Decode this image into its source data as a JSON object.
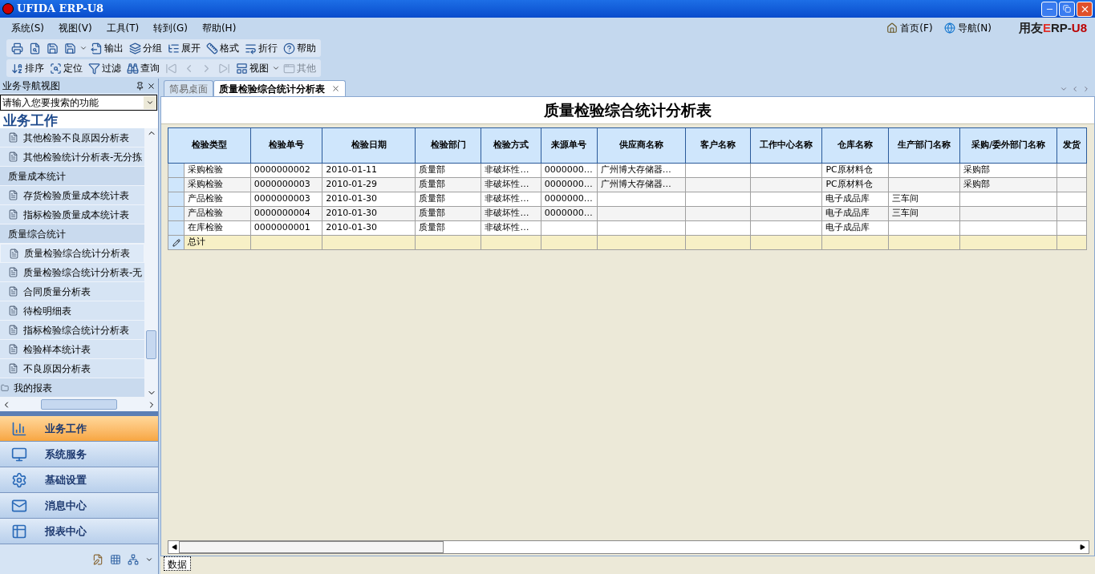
{
  "window": {
    "title": "UFIDA ERP-U8"
  },
  "menu": [
    "系统(S)",
    "视图(V)",
    "工具(T)",
    "转到(G)",
    "帮助(H)"
  ],
  "top_links": [
    "首页(F)",
    "导航(N)"
  ],
  "logo": [
    "用友",
    "E",
    "RP-",
    "U8"
  ],
  "toolbar1": [
    {
      "kind": "print"
    },
    {
      "kind": "preview"
    },
    {
      "kind": "export-disk"
    },
    {
      "kind": "save"
    },
    {
      "kind": "dropdown"
    },
    {
      "kind": "output",
      "label": "输出"
    },
    {
      "kind": "group",
      "label": "分组"
    },
    {
      "kind": "expand",
      "label": "展开"
    },
    {
      "kind": "format",
      "label": "格式"
    },
    {
      "kind": "wrap",
      "label": "折行"
    },
    {
      "kind": "help",
      "label": "帮助"
    }
  ],
  "toolbar2": [
    {
      "kind": "sort",
      "label": "排序",
      "disabled": false
    },
    {
      "kind": "locate",
      "label": "定位",
      "disabled": false
    },
    {
      "kind": "filter",
      "label": "过滤",
      "disabled": false
    },
    {
      "kind": "query",
      "label": "查询",
      "disabled": false
    },
    {
      "kind": "first",
      "disabled": true
    },
    {
      "kind": "prev",
      "disabled": true
    },
    {
      "kind": "next",
      "disabled": true
    },
    {
      "kind": "last",
      "disabled": true
    },
    {
      "kind": "view",
      "label": "视图",
      "disabled": false
    },
    {
      "kind": "dropdown"
    },
    {
      "kind": "other",
      "label": "其他",
      "disabled": true
    }
  ],
  "sidebar": {
    "title": "业务导航视图",
    "search_placeholder": "请输入您要搜索的功能",
    "heading": "业务工作",
    "items": [
      {
        "kind": "report",
        "label": "其他检验不良原因分析表",
        "selected": false
      },
      {
        "kind": "report",
        "label": "其他检验统计分析表-无分拣",
        "selected": false
      },
      {
        "kind": "group",
        "label": "质量成本统计",
        "selected": false
      },
      {
        "kind": "report",
        "label": "存货检验质量成本统计表",
        "selected": false
      },
      {
        "kind": "report",
        "label": "指标检验质量成本统计表",
        "selected": false
      },
      {
        "kind": "group",
        "label": "质量综合统计",
        "selected": false
      },
      {
        "kind": "report",
        "label": "质量检验综合统计分析表",
        "selected": true
      },
      {
        "kind": "report",
        "label": "质量检验综合统计分析表-无",
        "selected": false
      },
      {
        "kind": "report",
        "label": "合同质量分析表",
        "selected": false
      },
      {
        "kind": "report",
        "label": "待检明细表",
        "selected": false
      },
      {
        "kind": "report",
        "label": "指标检验综合统计分析表",
        "selected": false
      },
      {
        "kind": "report",
        "label": "检验样本统计表",
        "selected": false
      },
      {
        "kind": "report",
        "label": "不良原因分析表",
        "selected": false
      },
      {
        "kind": "folder",
        "label": "我的报表",
        "selected": false
      }
    ],
    "nav": [
      {
        "kind": "chart",
        "label": "业务工作",
        "selected": true
      },
      {
        "kind": "monitor",
        "label": "系统服务",
        "selected": false
      },
      {
        "kind": "settings",
        "label": "基础设置",
        "selected": false
      },
      {
        "kind": "mail",
        "label": "消息中心",
        "selected": false
      },
      {
        "kind": "reports",
        "label": "报表中心",
        "selected": false
      }
    ]
  },
  "tabs": [
    {
      "label": "简易桌面",
      "selected": false,
      "closable": false
    },
    {
      "label": "质量检验综合统计分析表",
      "selected": true,
      "closable": true
    }
  ],
  "report_title": "质量检验综合统计分析表",
  "table": {
    "columns": [
      "检验类型",
      "检验单号",
      "检验日期",
      "检验部门",
      "检验方式",
      "来源单号",
      "供应商名称",
      "客户名称",
      "工作中心名称",
      "仓库名称",
      "生产部门名称",
      "采购/委外部门名称",
      "发货"
    ],
    "rows": [
      [
        "采购检验",
        "0000000002",
        "2010-01-11",
        "质量部",
        "非破坏性…",
        "0000000…",
        "广州博大存储器…",
        "",
        "",
        "PC原材料仓",
        "",
        "采购部",
        ""
      ],
      [
        "采购检验",
        "0000000003",
        "2010-01-29",
        "质量部",
        "非破坏性…",
        "0000000…",
        "广州博大存储器…",
        "",
        "",
        "PC原材料仓",
        "",
        "采购部",
        ""
      ],
      [
        "产品检验",
        "0000000003",
        "2010-01-30",
        "质量部",
        "非破坏性…",
        "0000000…",
        "",
        "",
        "",
        "电子成品库",
        "三车间",
        "",
        ""
      ],
      [
        "产品检验",
        "0000000004",
        "2010-01-30",
        "质量部",
        "非破坏性…",
        "0000000…",
        "",
        "",
        "",
        "电子成品库",
        "三车间",
        "",
        ""
      ],
      [
        "在库检验",
        "0000000001",
        "2010-01-30",
        "质量部",
        "非破坏性…",
        "",
        "",
        "",
        "",
        "电子成品库",
        "",
        "",
        ""
      ]
    ],
    "total_label": "总计"
  },
  "bottom_tabs": [
    "数据"
  ]
}
